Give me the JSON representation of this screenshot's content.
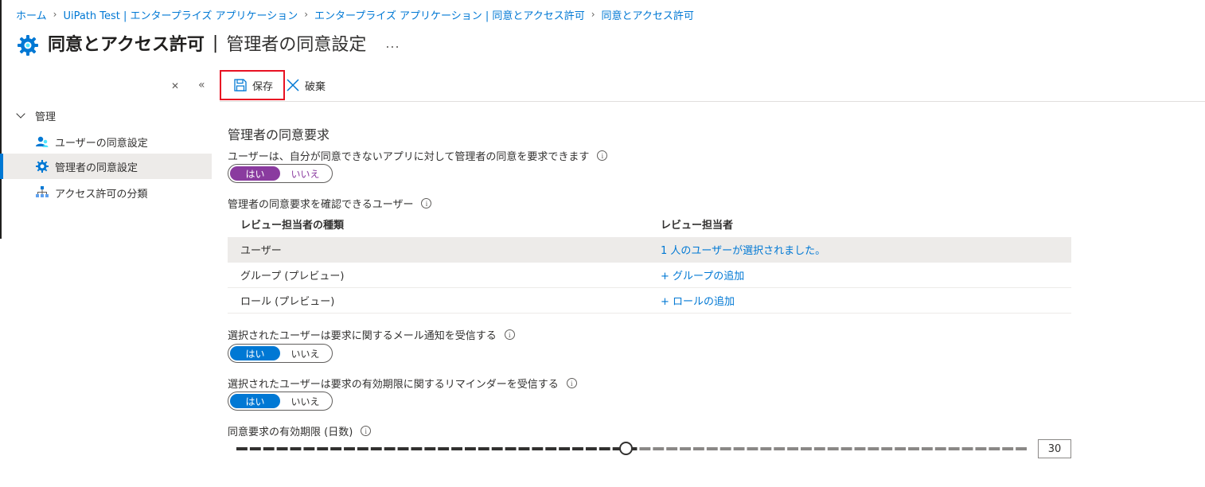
{
  "breadcrumb": [
    {
      "label": "ホーム"
    },
    {
      "label": "UiPath Test | エンタープライズ アプリケーション"
    },
    {
      "label": "エンタープライズ アプリケーション | 同意とアクセス許可"
    },
    {
      "label": "同意とアクセス許可"
    }
  ],
  "header": {
    "title_main": "同意とアクセス許可",
    "title_sep": "|",
    "title_sub": "管理者の同意設定",
    "more": "..."
  },
  "sidebar": {
    "section": "管理",
    "items": [
      {
        "label": "ユーザーの同意設定",
        "icon": "users-icon"
      },
      {
        "label": "管理者の同意設定",
        "icon": "gear-icon",
        "active": true
      },
      {
        "label": "アクセス許可の分類",
        "icon": "hierarchy-icon"
      }
    ]
  },
  "toolbar": {
    "save_label": "保存",
    "discard_label": "破棄"
  },
  "content": {
    "section_title": "管理者の同意要求",
    "request_label": "ユーザーは、自分が同意できないアプリに対して管理者の同意を要求できます",
    "toggle_request": {
      "yes": "はい",
      "no": "いいえ",
      "selected": "はい"
    },
    "reviewers_label": "管理者の同意要求を確認できるユーザー",
    "reviewers_table": {
      "columns": [
        "レビュー担当者の種類",
        "レビュー担当者"
      ],
      "rows": [
        {
          "type": "ユーザー",
          "reviewer": "1 人のユーザーが選択されました。"
        },
        {
          "type": "グループ (プレビュー)",
          "reviewer": "+ グループの追加"
        },
        {
          "type": "ロール (プレビュー)",
          "reviewer": "+ ロールの追加"
        }
      ]
    },
    "email_label": "選択されたユーザーは要求に関するメール通知を受信する",
    "toggle_email": {
      "yes": "はい",
      "no": "いいえ",
      "selected": "はい"
    },
    "reminder_label": "選択されたユーザーは要求の有効期限に関するリマインダーを受信する",
    "toggle_reminder": {
      "yes": "はい",
      "no": "いいえ",
      "selected": "はい"
    },
    "expiry_label": "同意要求の有効期限 (日数)",
    "expiry_value": "30",
    "expiry_slider": {
      "min": 1,
      "max": 60,
      "value": 30
    }
  },
  "colors": {
    "accent": "#0078d4",
    "toggle_purple": "#8a3b9f",
    "save_highlight": "#e81123"
  }
}
